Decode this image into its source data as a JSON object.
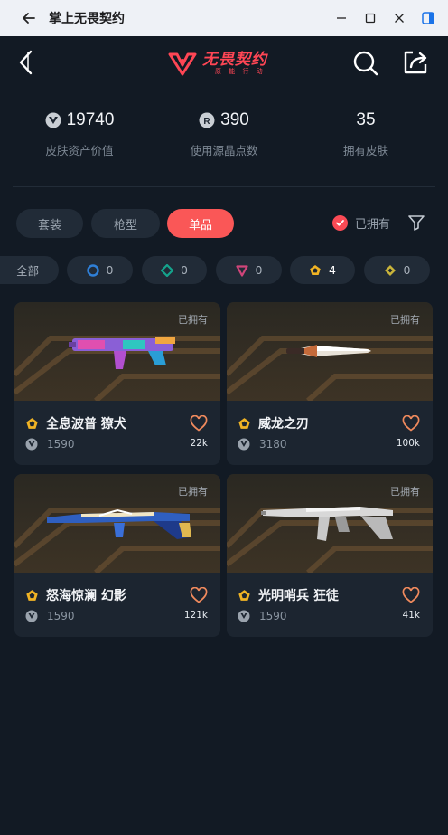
{
  "window": {
    "title": "掌上无畏契约"
  },
  "header": {
    "logo_main": "无畏契约",
    "logo_sub": "原 能 行 动"
  },
  "stats": [
    {
      "value": "19740",
      "label": "皮肤资产价值",
      "icon": "vp-coin-icon"
    },
    {
      "value": "390",
      "label": "使用源晶点数",
      "icon": "radianite-icon"
    },
    {
      "value": "35",
      "label": "拥有皮肤",
      "icon": ""
    }
  ],
  "tabs": [
    {
      "label": "套装",
      "active": false
    },
    {
      "label": "枪型",
      "active": false
    },
    {
      "label": "单品",
      "active": true
    }
  ],
  "owned_filter": {
    "label": "已拥有",
    "checked": true
  },
  "rarity_chips": [
    {
      "label": "全部"
    },
    {
      "count": "0",
      "tier": "select",
      "color": "#2f7fd6"
    },
    {
      "count": "0",
      "tier": "deluxe",
      "color": "#15a38c"
    },
    {
      "count": "0",
      "tier": "premium",
      "color": "#d0457a"
    },
    {
      "count": "4",
      "tier": "exclusive",
      "color": "#f0b324",
      "selected": true
    },
    {
      "count": "0",
      "tier": "ultra",
      "color": "#c9b43a"
    }
  ],
  "cards": [
    {
      "owned": "已拥有",
      "name": "全息波普 獠犬",
      "price": "1590",
      "likes": "22k",
      "weapon": "odin"
    },
    {
      "owned": "已拥有",
      "name": "威龙之刃",
      "price": "3180",
      "likes": "100k",
      "weapon": "knife"
    },
    {
      "owned": "已拥有",
      "name": "怒海惊澜 幻影",
      "price": "1590",
      "likes": "121k",
      "weapon": "phantom"
    },
    {
      "owned": "已拥有",
      "name": "光明哨兵 狂徒",
      "price": "1590",
      "likes": "41k",
      "weapon": "vandal"
    }
  ],
  "colors": {
    "accent": "#fa5757",
    "background": "#121a24",
    "card": "#1c2530",
    "tier_gold": "#f0b324"
  }
}
